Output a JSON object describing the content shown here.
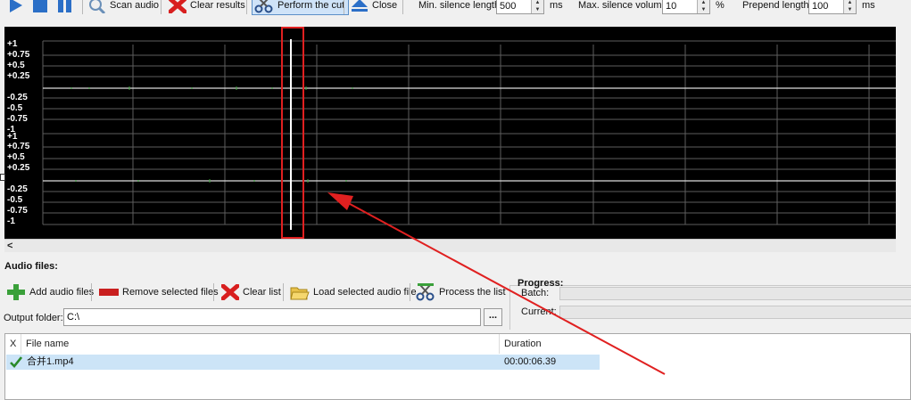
{
  "toolbar": {
    "scan_label": "Scan audio",
    "clear_results_label": "Clear results",
    "perform_cut_label": "Perform the cut",
    "close_label": "Close"
  },
  "settings": {
    "min_silence_label": "Min. silence length:",
    "min_silence_value": "500",
    "min_silence_unit": "ms",
    "max_volume_label": "Max. silence volume:",
    "max_volume_value": "10",
    "max_volume_unit": "%",
    "prepend_label": "Prepend length:",
    "prepend_value": "100",
    "prepend_unit": "ms"
  },
  "waveform": {
    "channel1_labels": [
      "+1",
      "+0.75",
      "+0.5",
      "+0.25",
      "-0.25",
      "-0.5",
      "-0.75",
      "-1"
    ],
    "channel2_labels": [
      "+1",
      "+0.75",
      "+0.5",
      "+0.25",
      "-0.25",
      "-0.5",
      "-0.75",
      "-1"
    ],
    "scroll_left": "<"
  },
  "audio_files": {
    "title": "Audio files:",
    "add_label": "Add audio files",
    "remove_label": "Remove selected files",
    "clear_label": "Clear list",
    "load_label": "Load selected audio file",
    "process_label": "Process the list"
  },
  "output": {
    "label": "Output folder:",
    "value": "C:\\",
    "browse_label": "..."
  },
  "progress": {
    "title": "Progress:",
    "batch_label": "Batch:",
    "current_label": "Current:",
    "batch_fraction": 0,
    "current_fraction": 0
  },
  "table": {
    "columns": [
      "X",
      "File name",
      "Duration"
    ],
    "rows": [
      {
        "filename": "合并1.mp4",
        "duration": "00:00:06.39",
        "status": "done"
      }
    ]
  },
  "colors": {
    "selection": "#cce4f7",
    "annotation": "#e02020",
    "waveform_bg": "#000000"
  }
}
